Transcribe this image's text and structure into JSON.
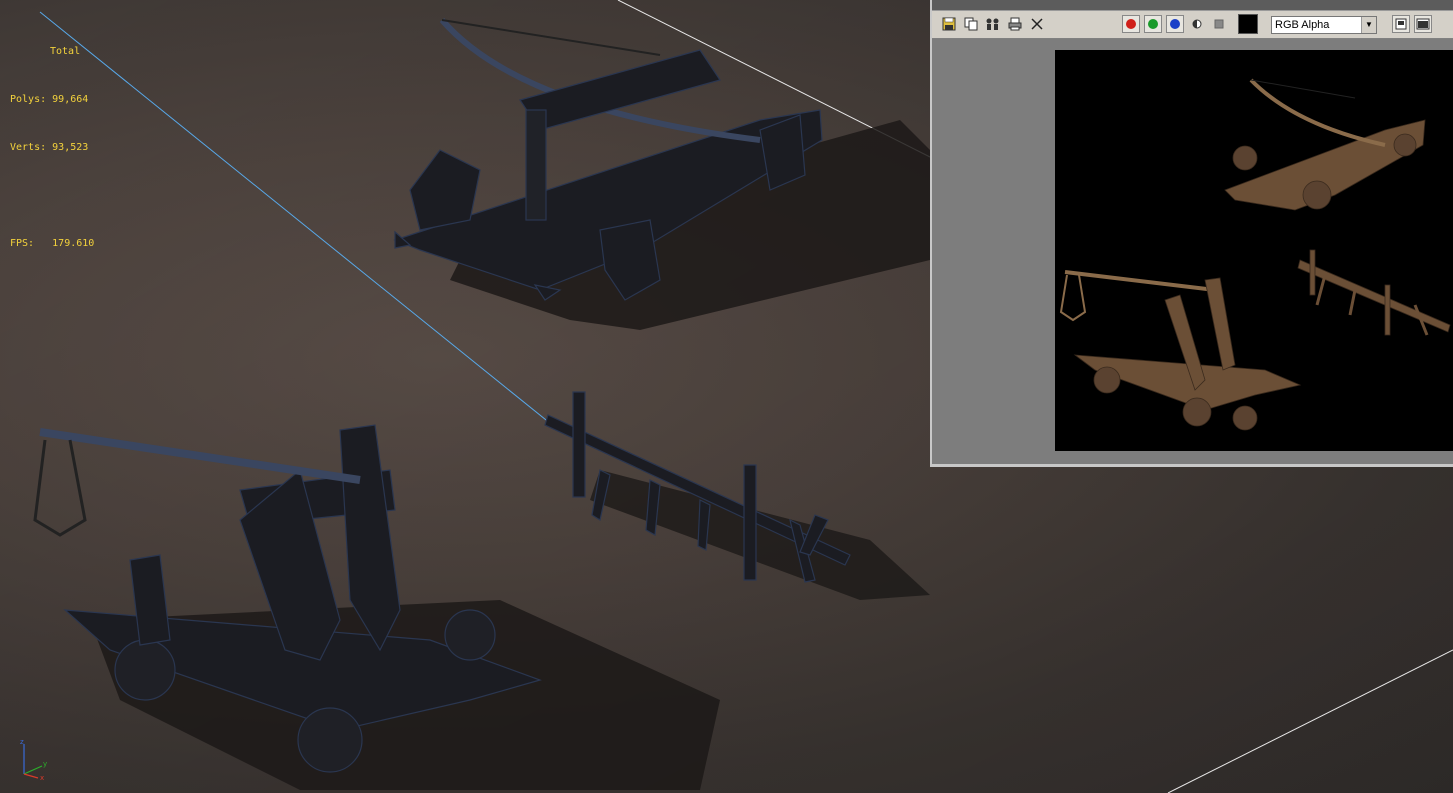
{
  "viewport": {
    "stats": {
      "total_label": "Total",
      "polys_label": "Polys:",
      "polys_value": "99,664",
      "verts_label": "Verts:",
      "verts_value": "93,523",
      "fps_label": "FPS:",
      "fps_value": "179.610"
    },
    "axis": {
      "x": "x",
      "y": "y",
      "z": "z"
    },
    "colors": {
      "stats_text": "#f3d23c",
      "background": "#4d433e",
      "wire": "#2b3a55"
    }
  },
  "frame_window": {
    "toolbar": {
      "icons": [
        "save-icon",
        "clone-icon",
        "track-icon",
        "print-icon",
        "clear-icon"
      ],
      "channels": [
        "red",
        "green",
        "blue"
      ],
      "channel_colors": [
        "#d0201a",
        "#1a9a2a",
        "#1a3fc8"
      ],
      "display_mode": "RGB Alpha"
    },
    "colors": {
      "toolbar_bg": "#d4d0c8",
      "canvas_bg": "#000000"
    }
  }
}
